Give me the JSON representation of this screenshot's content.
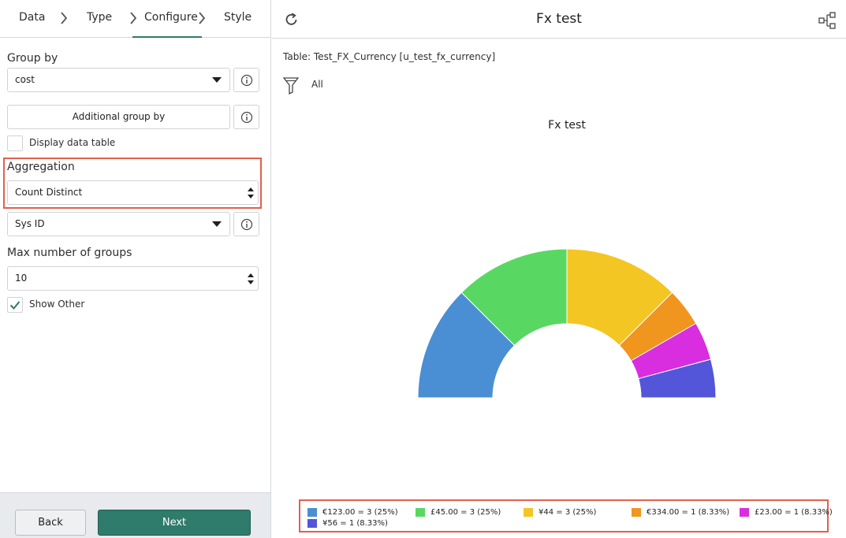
{
  "steps": [
    "Data",
    "Type",
    "Configure",
    "Style"
  ],
  "group_by": {
    "label": "Group by",
    "value": "cost"
  },
  "additional_group_by": "Additional group by",
  "display_data_table": {
    "label": "Display data table",
    "checked": false
  },
  "aggregation": {
    "label": "Aggregation",
    "value": "Count Distinct"
  },
  "aggregation_field": {
    "value": "Sys ID"
  },
  "max_groups": {
    "label": "Max number of groups",
    "value": "10"
  },
  "show_other": {
    "label": "Show Other",
    "checked": true
  },
  "buttons": {
    "back": "Back",
    "next": "Next"
  },
  "header": {
    "title": "Fx test"
  },
  "table_info": "Table: Test_FX_Currency [u_test_fx_currency]",
  "filter": "All",
  "colors": {
    "accent": "#2f7b6c",
    "highlight": "#e35f4e"
  },
  "chart_data": {
    "type": "pie",
    "subtype": "semi-donut",
    "title": "Fx test",
    "slices": [
      {
        "label": "€123.00",
        "value": 3,
        "percent": "25%",
        "color": "#4a8ed4"
      },
      {
        "label": "£45.00",
        "value": 3,
        "percent": "25%",
        "color": "#58d862"
      },
      {
        "label": "¥44",
        "value": 3,
        "percent": "25%",
        "color": "#f4c623"
      },
      {
        "label": "€334.00",
        "value": 1,
        "percent": "8.33%",
        "color": "#f0951e"
      },
      {
        "label": "£23.00",
        "value": 1,
        "percent": "8.33%",
        "color": "#d92de0"
      },
      {
        "label": "¥56",
        "value": 1,
        "percent": "8.33%",
        "color": "#5356d8"
      }
    ],
    "legend": [
      "€123.00 = 3 (25%)",
      "£45.00 = 3 (25%)",
      "¥44 = 3 (25%)",
      "€334.00 = 1 (8.33%)",
      "£23.00 = 1 (8.33%)",
      "¥56 = 1 (8.33%)"
    ]
  }
}
